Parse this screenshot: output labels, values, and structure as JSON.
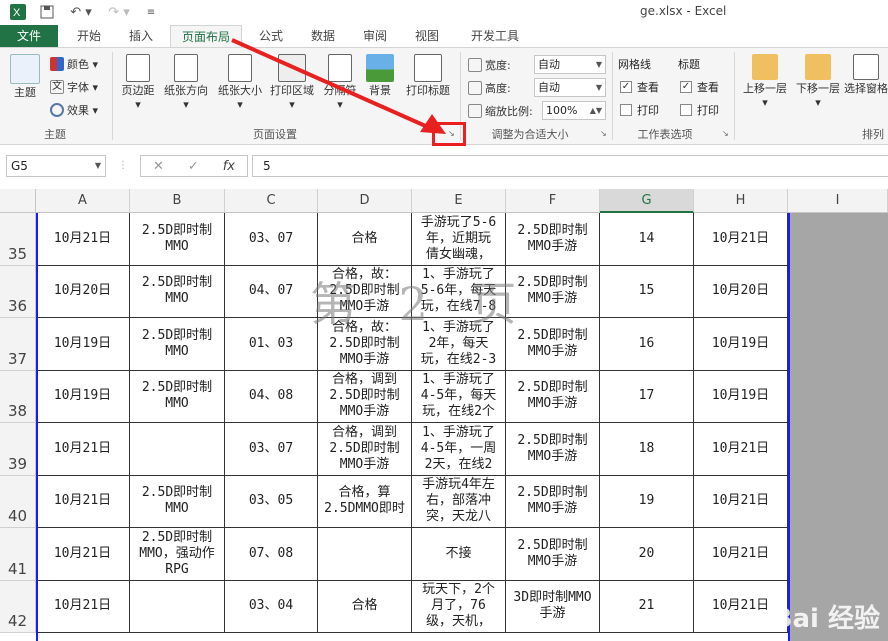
{
  "window": {
    "title": "ge.xlsx - Excel"
  },
  "tabs": [
    "文件",
    "开始",
    "插入",
    "页面布局",
    "公式",
    "数据",
    "审阅",
    "视图",
    "开发工具"
  ],
  "ribbon": {
    "theme_group": {
      "label": "主题",
      "themes": "主题",
      "colors": "颜色",
      "fonts": "字体",
      "effects": "效果"
    },
    "page_setup": {
      "label": "页面设置",
      "margins": "页边距",
      "orientation": "纸张方向",
      "size": "纸张大小",
      "print_area": "打印区域",
      "breaks": "分隔符",
      "background": "背景",
      "print_titles": "打印标题"
    },
    "scale_to_fit": {
      "label": "调整为合适大小",
      "width_label": "宽度:",
      "width_value": "自动",
      "height_label": "高度:",
      "height_value": "自动",
      "scale_label": "缩放比例:",
      "scale_value": "100%"
    },
    "sheet_options": {
      "label": "工作表选项",
      "gridlines": "网格线",
      "headings": "标题",
      "view": "查看",
      "print": "打印"
    },
    "arrange": {
      "label": "排列",
      "bring_forward": "上移一层",
      "send_backward": "下移一层",
      "selection_pane": "选择窗格"
    }
  },
  "formula_bar": {
    "name_box": "G5",
    "value": "5"
  },
  "columns": [
    "A",
    "B",
    "C",
    "D",
    "E",
    "F",
    "G",
    "H",
    "I"
  ],
  "selected_column": "G",
  "rows": [
    {
      "num": "35",
      "cells": [
        "10月21日",
        "2.5D即时制\nMMO",
        "03、07",
        "合格",
        "手游玩了5-6\n年，近期玩\n倩女幽魂，",
        "2.5D即时制\nMMO手游",
        "14",
        "10月21日"
      ]
    },
    {
      "num": "36",
      "cells": [
        "10月20日",
        "2.5D即时制\nMMO",
        "04、07",
        "合格，故：\n2.5D即时制\nMMO手游",
        "1、手游玩了\n5-6年，每天\n玩，在线7-8",
        "2.5D即时制\nMMO手游",
        "15",
        "10月20日"
      ]
    },
    {
      "num": "37",
      "cells": [
        "10月19日",
        "2.5D即时制\nMMO",
        "01、03",
        "合格，故：\n2.5D即时制\nMMO手游",
        "1、手游玩了\n2年，每天\n玩，在线2-3",
        "2.5D即时制\nMMO手游",
        "16",
        "10月19日"
      ]
    },
    {
      "num": "38",
      "cells": [
        "10月19日",
        "2.5D即时制\nMMO",
        "04、08",
        "合格，调到\n2.5D即时制\nMMO手游",
        "1、手游玩了\n4-5年，每天\n玩，在线2个",
        "2.5D即时制\nMMO手游",
        "17",
        "10月19日"
      ]
    },
    {
      "num": "39",
      "cells": [
        "10月21日",
        "",
        "03、07",
        "合格，调到\n2.5D即时制\nMMO手游",
        "1、手游玩了\n4-5年，一周\n2天，在线2",
        "2.5D即时制\nMMO手游",
        "18",
        "10月21日"
      ]
    },
    {
      "num": "40",
      "cells": [
        "10月21日",
        "2.5D即时制\nMMO",
        "03、05",
        "合格，算\n2.5DMMO即时",
        "手游玩4年左\n右，部落冲\n突，天龙八",
        "2.5D即时制\nMMO手游",
        "19",
        "10月21日"
      ]
    },
    {
      "num": "41",
      "cells": [
        "10月21日",
        "2.5D即时制\nMMO，强动作\nRPG",
        "07、08",
        "",
        "不接",
        "2.5D即时制\nMMO手游",
        "20",
        "10月21日"
      ]
    },
    {
      "num": "42",
      "cells": [
        "10月21日",
        "",
        "03、04",
        "合格",
        "玩天下，2个\n月了，76\n级，天机，",
        "3D即时制MMO\n手游",
        "21",
        "10月21日"
      ]
    }
  ],
  "page_watermark": "第 2 页",
  "site_watermark": "Bai 经验"
}
